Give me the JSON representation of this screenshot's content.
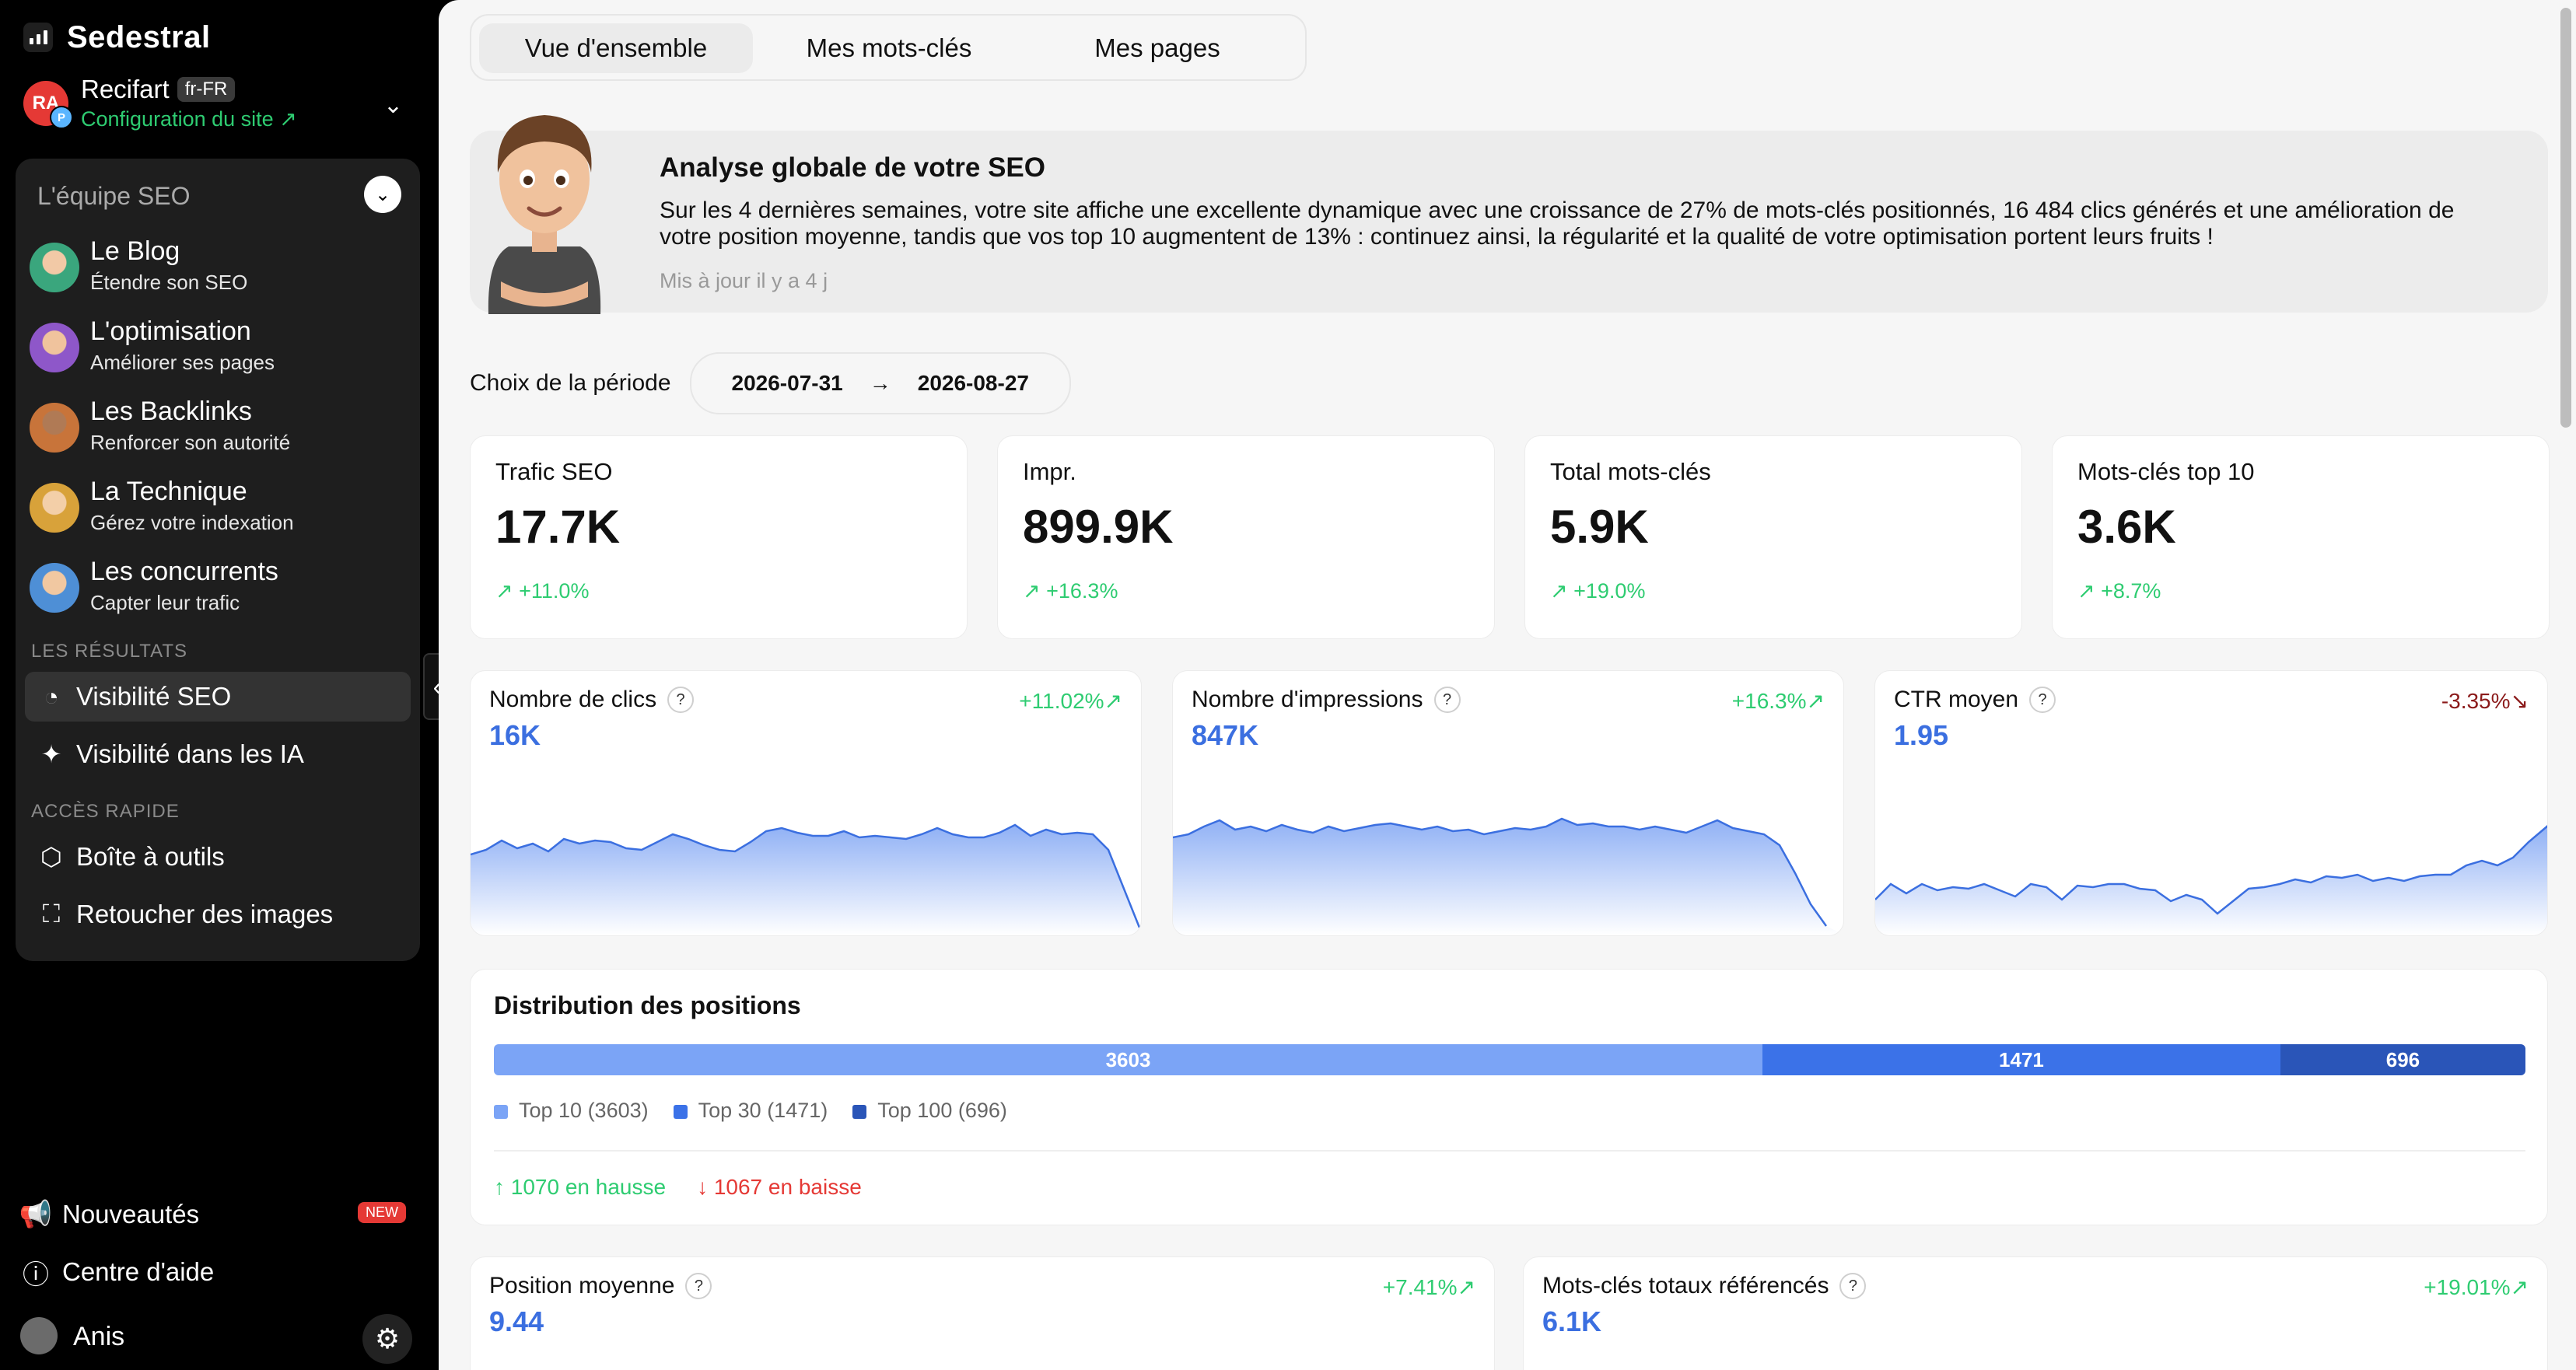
{
  "brand": {
    "name": "Sedestral"
  },
  "site": {
    "name": "Recifart",
    "locale": "fr-FR",
    "config_link": "Configuration du site ↗",
    "avatar_initials": "RA",
    "avatar_badge": "P"
  },
  "team": {
    "heading": "L'équipe SEO",
    "agents": [
      {
        "title": "Le Blog",
        "subtitle": "Étendre son SEO",
        "color": "#3aa67d"
      },
      {
        "title": "L'optimisation",
        "subtitle": "Améliorer ses pages",
        "color": "#8e57c9"
      },
      {
        "title": "Les Backlinks",
        "subtitle": "Renforcer son autorité",
        "color": "#c8743a"
      },
      {
        "title": "La Technique",
        "subtitle": "Gérez votre indexation",
        "color": "#d8a23a"
      },
      {
        "title": "Les concurrents",
        "subtitle": "Capter leur trafic",
        "color": "#4e8fd6"
      }
    ]
  },
  "sections": {
    "results": "LES RÉSULTATS",
    "quick": "ACCÈS RAPIDE"
  },
  "nav": {
    "visibility_seo": "Visibilité SEO",
    "visibility_ai": "Visibilité dans les IA",
    "toolbox": "Boîte à outils",
    "retouch": "Retoucher des images"
  },
  "footer": {
    "news": "Nouveautés",
    "new_badge": "NEW",
    "help": "Centre d'aide",
    "user": "Anis"
  },
  "tabs": [
    "Vue d'ensemble",
    "Mes mots-clés",
    "Mes pages"
  ],
  "hero": {
    "title": "Analyse globale de votre SEO",
    "text": "Sur les 4 dernières semaines, votre site affiche une excellente dynamique avec une croissance de 27% de mots-clés positionnés, 16 484 clics générés et une amélioration de votre position moyenne, tandis que vos top 10 augmentent de 13% : continuez ainsi, la régularité et la qualité de votre optimisation portent leurs fruits !",
    "updated": "Mis à jour il y a 4 j"
  },
  "period": {
    "label": "Choix de la période",
    "start": "2026-07-31",
    "arrow": "→",
    "end": "2026-08-27"
  },
  "kpis": [
    {
      "label": "Trafic SEO",
      "value": "17.7K",
      "delta": "↗ +11.0%"
    },
    {
      "label": "Impr.",
      "value": "899.9K",
      "delta": "↗ +16.3%"
    },
    {
      "label": "Total mots-clés",
      "value": "5.9K",
      "delta": "↗ +19.0%"
    },
    {
      "label": "Mots-clés top 10",
      "value": "3.6K",
      "delta": "↗ +8.7%"
    }
  ],
  "metrics": [
    {
      "label": "Nombre de clics",
      "value": "16K",
      "delta": "+11.02%↗",
      "trend": "up"
    },
    {
      "label": "Nombre d'impressions",
      "value": "847K",
      "delta": "+16.3%↗",
      "trend": "up"
    },
    {
      "label": "CTR moyen",
      "value": "1.95",
      "delta": "-3.35%↘",
      "trend": "down"
    }
  ],
  "help_icon": "?",
  "distribution": {
    "title": "Distribution des positions",
    "segments": [
      {
        "label": "3603",
        "value": 3603,
        "color": "#7ba4f6"
      },
      {
        "label": "1471",
        "value": 1471,
        "color": "#3b72e8"
      },
      {
        "label": "696",
        "value": 696,
        "color": "#2a55b8"
      }
    ],
    "legend": [
      "Top 10 (3603)",
      "Top 30 (1471)",
      "Top 100 (696)"
    ],
    "up": "1070 en hausse",
    "down": "1067 en baisse"
  },
  "bottom_metrics": [
    {
      "label": "Position moyenne",
      "value": "9.44",
      "delta": "+7.41%↗"
    },
    {
      "label": "Mots-clés totaux référencés",
      "value": "6.1K",
      "delta": "+19.01%↗"
    }
  ]
}
